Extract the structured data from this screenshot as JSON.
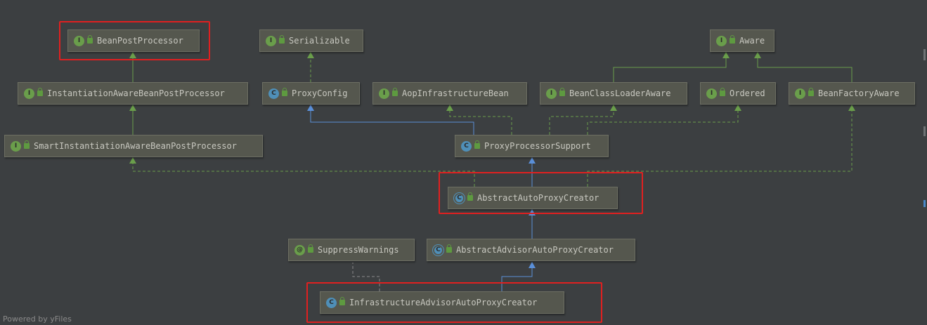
{
  "nodes": [
    {
      "id": "bpp",
      "label": "BeanPostProcessor",
      "kind": "I",
      "icon": "interface-icon"
    },
    {
      "id": "ser",
      "label": "Serializable",
      "kind": "I",
      "icon": "interface-icon"
    },
    {
      "id": "aware",
      "label": "Aware",
      "kind": "I",
      "icon": "interface-icon"
    },
    {
      "id": "iabpp",
      "label": "InstantiationAwareBeanPostProcessor",
      "kind": "I",
      "icon": "interface-icon"
    },
    {
      "id": "pconf",
      "label": "ProxyConfig",
      "kind": "C",
      "icon": "class-icon"
    },
    {
      "id": "aib",
      "label": "AopInfrastructureBean",
      "kind": "I",
      "icon": "interface-icon"
    },
    {
      "id": "bcla",
      "label": "BeanClassLoaderAware",
      "kind": "I",
      "icon": "interface-icon"
    },
    {
      "id": "ord",
      "label": "Ordered",
      "kind": "I",
      "icon": "interface-icon"
    },
    {
      "id": "bfa",
      "label": "BeanFactoryAware",
      "kind": "I",
      "icon": "interface-icon"
    },
    {
      "id": "siabpp",
      "label": "SmartInstantiationAwareBeanPostProcessor",
      "kind": "I",
      "icon": "interface-icon"
    },
    {
      "id": "pps",
      "label": "ProxyProcessorSupport",
      "kind": "C",
      "icon": "class-icon"
    },
    {
      "id": "aapc",
      "label": "AbstractAutoProxyCreator",
      "kind": "C",
      "icon": "abstract-class-icon"
    },
    {
      "id": "sw",
      "label": "SuppressWarnings",
      "kind": "@",
      "icon": "annotation-icon"
    },
    {
      "id": "aaapc",
      "label": "AbstractAdvisorAutoProxyCreator",
      "kind": "C",
      "icon": "abstract-class-icon"
    },
    {
      "id": "iaapc",
      "label": "InfrastructureAdvisorAutoProxyCreator",
      "kind": "C",
      "icon": "class-icon"
    }
  ],
  "edges": [
    {
      "from": "iabpp",
      "to": "bpp",
      "style": "extends"
    },
    {
      "from": "siabpp",
      "to": "iabpp",
      "style": "extends"
    },
    {
      "from": "pconf",
      "to": "ser",
      "style": "implements"
    },
    {
      "from": "bcla",
      "to": "aware",
      "style": "extends"
    },
    {
      "from": "bfa",
      "to": "aware",
      "style": "extends"
    },
    {
      "from": "pps",
      "to": "pconf",
      "style": "extends"
    },
    {
      "from": "pps",
      "to": "aib",
      "style": "implements"
    },
    {
      "from": "pps",
      "to": "bcla",
      "style": "implements"
    },
    {
      "from": "pps",
      "to": "ord",
      "style": "implements"
    },
    {
      "from": "aapc",
      "to": "pps",
      "style": "extends"
    },
    {
      "from": "aapc",
      "to": "siabpp",
      "style": "implements"
    },
    {
      "from": "aapc",
      "to": "bfa",
      "style": "implements"
    },
    {
      "from": "aaapc",
      "to": "aapc",
      "style": "extends"
    },
    {
      "from": "iaapc",
      "to": "aaapc",
      "style": "extends"
    },
    {
      "from": "iaapc",
      "to": "sw",
      "style": "annotation"
    }
  ],
  "highlighted": [
    "bpp",
    "aapc",
    "iaapc"
  ],
  "colors": {
    "background": "#3c3f41",
    "node": "#55574e",
    "highlight": "#e02020",
    "implements_edge": "#6a9e4b",
    "extends_class_edge": "#5a8fd8",
    "annotation_edge": "#8a8a8a"
  },
  "footer": {
    "watermark": "Powered by yFiles"
  }
}
